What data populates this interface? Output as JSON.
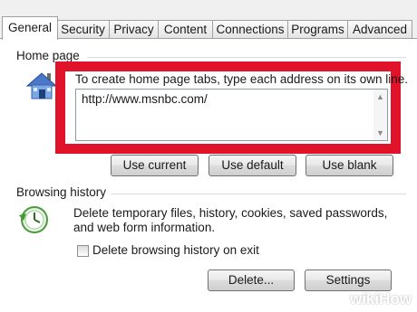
{
  "tabs": [
    {
      "label": "General",
      "active": true
    },
    {
      "label": "Security",
      "active": false
    },
    {
      "label": "Privacy",
      "active": false
    },
    {
      "label": "Content",
      "active": false
    },
    {
      "label": "Connections",
      "active": false
    },
    {
      "label": "Programs",
      "active": false
    },
    {
      "label": "Advanced",
      "active": false
    }
  ],
  "home_page": {
    "group_label": "Home page",
    "instruction": "To create home page tabs, type each address on its own line.",
    "url_value": "http://www.msnbc.com/",
    "buttons": {
      "use_current": "Use current",
      "use_default": "Use default",
      "use_blank": "Use blank"
    },
    "icon": "house-icon"
  },
  "browsing_history": {
    "group_label": "Browsing history",
    "description": "Delete temporary files, history, cookies, saved passwords, and web form information.",
    "delete_on_exit_label": "Delete browsing history on exit",
    "delete_on_exit_checked": false,
    "buttons": {
      "delete": "Delete...",
      "settings": "Settings"
    },
    "icon": "history-clock-icon"
  },
  "watermark": "wikiHow",
  "colors": {
    "highlight": "#e0132b",
    "group_line": "#d5dfe5",
    "tab_border": "#a0a0a0"
  }
}
